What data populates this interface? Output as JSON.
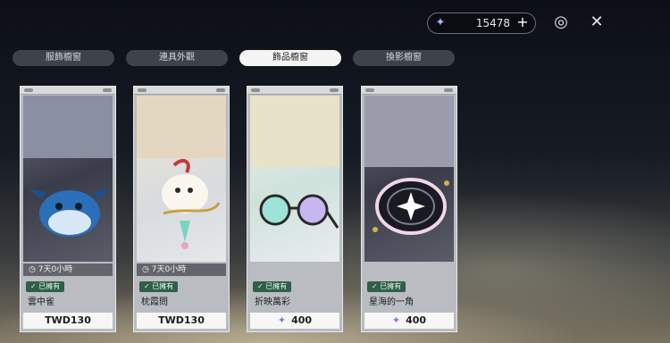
{
  "header": {
    "currency_amount": "15478",
    "currency_icon": "crystal-star-icon",
    "plus_icon": "plus-icon",
    "settings_icon": "target-gear-icon",
    "close_icon": "sparkle-close-icon"
  },
  "tabs": [
    {
      "label": "服飾櫥窗"
    },
    {
      "label": "連具外觀"
    },
    {
      "label": "飾品櫥窗"
    },
    {
      "label": "換影櫥窗"
    }
  ],
  "cards": [
    {
      "timer": "7天0小時",
      "owned": "已擁有",
      "name": "雲中雀",
      "price": "TWD130"
    },
    {
      "timer": "7天0小時",
      "owned": "已擁有",
      "name": "枕霞問",
      "price": "TWD130"
    },
    {
      "owned": "已擁有",
      "name": "折映萬彩",
      "price": "400",
      "price_icon": "crystal-star-icon"
    },
    {
      "owned": "已擁有",
      "name": "星海的一角",
      "price": "400",
      "price_icon": "crystal-star-icon"
    }
  ]
}
